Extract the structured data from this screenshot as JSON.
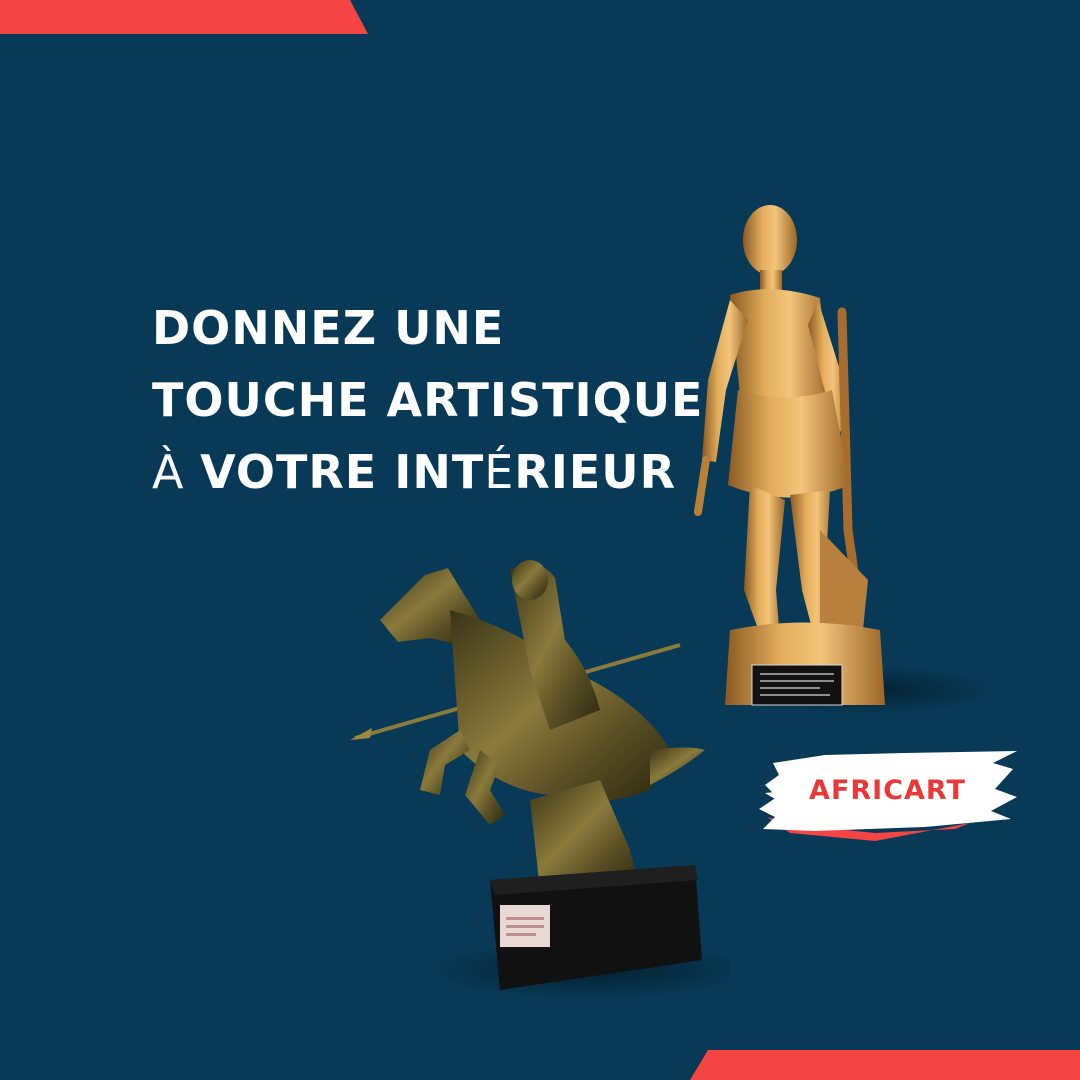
{
  "headline": {
    "line1": "DONNEZ UNE",
    "line2": "TOUCHE ARTISTIQUE",
    "line3_a": "À ",
    "line3_b": "VOTRE INT",
    "line3_c": "É",
    "line3_d": "RIEUR"
  },
  "badge": {
    "label": "AFRICART"
  },
  "colors": {
    "background": "#083a57",
    "accent": "#f44444",
    "text": "#ffffff",
    "gold": "#d6a04a",
    "bronze": "#6b5a2a"
  }
}
